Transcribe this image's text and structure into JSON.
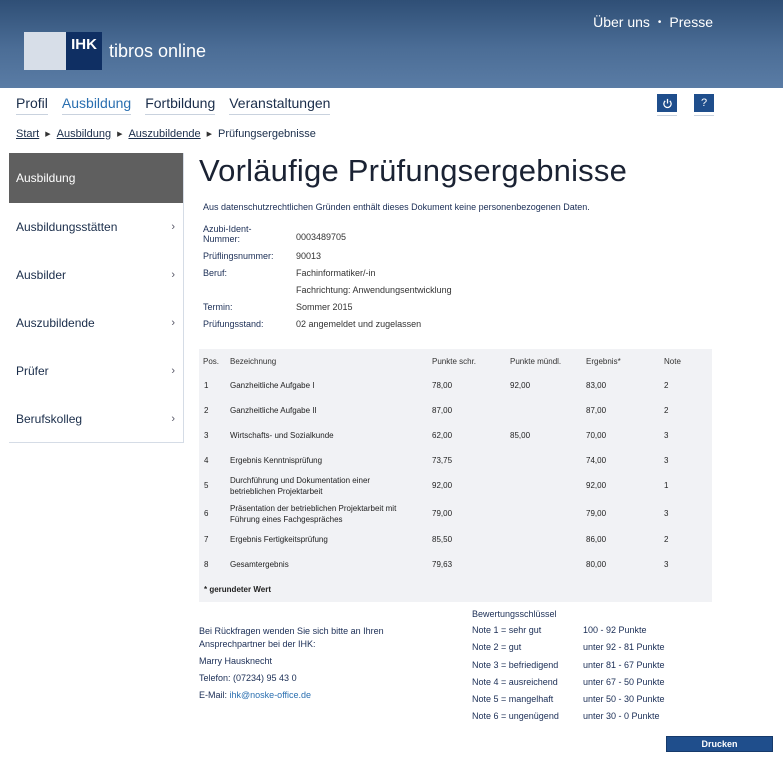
{
  "header": {
    "logo_mark": "IHK",
    "app_name": "tibros online",
    "links": [
      "Über uns",
      "Presse"
    ]
  },
  "nav": {
    "items": [
      "Profil",
      "Ausbildung",
      "Fortbildung",
      "Veranstaltungen"
    ],
    "active": "Ausbildung",
    "power_icon": "power-icon",
    "help_label": "?"
  },
  "breadcrumb": [
    "Start",
    "Ausbildung",
    "Auszubildende",
    "Prüfungsergebnisse"
  ],
  "sidebar": {
    "items": [
      {
        "label": "Ausbildung",
        "active": true
      },
      {
        "label": "Ausbildungsstätten"
      },
      {
        "label": "Ausbilder"
      },
      {
        "label": "Auszubildende"
      },
      {
        "label": "Prüfer"
      },
      {
        "label": "Berufskolleg"
      }
    ]
  },
  "main": {
    "title": "Vorläufige Prüfungsergebnisse",
    "note": "Aus datenschutzrechtlichen Gründen enthält dieses Dokument keine personenbezogenen Daten.",
    "meta": {
      "azubi_label": "Azubi-Ident-Nummer:",
      "azubi_label_line1": "Azubi-Ident-",
      "azubi_label_line2": "Nummer:",
      "azubi_value": "0003489705",
      "pruefling_label": "Prüflingsnummer:",
      "pruefling_value": "90013",
      "beruf_label": "Beruf:",
      "beruf_value": "Fachinformatiker/-in",
      "fachrichtung_value": "Fachrichtung: Anwendungsentwicklung",
      "termin_label": "Termin:",
      "termin_value": "Sommer 2015",
      "stand_label": "Prüfungsstand:",
      "stand_value": "02 angemeldet und zugelassen"
    }
  },
  "results": {
    "headers": [
      "Pos.",
      "Bezeichnung",
      "Punkte schr.",
      "Punkte mündl.",
      "Ergebnis*",
      "Note"
    ],
    "rows": [
      {
        "pos": "1",
        "bez1": "Ganzheitliche Aufgabe I",
        "bez2": "",
        "schr": "78,00",
        "muendl": "92,00",
        "erg": "83,00",
        "note": "2"
      },
      {
        "pos": "2",
        "bez1": "Ganzheitliche Aufgabe II",
        "bez2": "",
        "schr": "87,00",
        "muendl": "",
        "erg": "87,00",
        "note": "2"
      },
      {
        "pos": "3",
        "bez1": "Wirtschafts- und Sozialkunde",
        "bez2": "",
        "schr": "62,00",
        "muendl": "85,00",
        "erg": "70,00",
        "note": "3"
      },
      {
        "pos": "4",
        "bez1": "Ergebnis Kenntnisprüfung",
        "bez2": "",
        "schr": "73,75",
        "muendl": "",
        "erg": "74,00",
        "note": "3"
      },
      {
        "pos": "5",
        "bez1": "Durchführung und Dokumentation einer",
        "bez2": "betrieblichen Projektarbeit",
        "schr": "92,00",
        "muendl": "",
        "erg": "92,00",
        "note": "1"
      },
      {
        "pos": "6",
        "bez1": "Präsentation der betrieblichen Projektarbeit mit",
        "bez2": "Führung eines Fachgespräches",
        "schr": "79,00",
        "muendl": "",
        "erg": "79,00",
        "note": "3"
      },
      {
        "pos": "7",
        "bez1": "Ergebnis Fertigkeitsprüfung",
        "bez2": "",
        "schr": "85,50",
        "muendl": "",
        "erg": "86,00",
        "note": "2"
      },
      {
        "pos": "8",
        "bez1": "Gesamtergebnis",
        "bez2": "",
        "schr": "79,63",
        "muendl": "",
        "erg": "80,00",
        "note": "3"
      }
    ],
    "footnote": "* gerundeter Wert"
  },
  "contact": {
    "line1": "Bei Rückfragen wenden Sie sich bitte an Ihren",
    "line2": "Ansprechpartner bei der IHK:",
    "name": "Marry Hausknecht",
    "phone": "Telefon: (07234) 95 43 0",
    "email_label": "E-Mail:",
    "email": "ihk@noske-office.de"
  },
  "key": {
    "title": "Bewertungsschlüssel",
    "rows": [
      {
        "note": "Note 1 = sehr gut",
        "range": "100 - 92 Punkte"
      },
      {
        "note": "Note 2 = gut",
        "range": "unter 92 - 81 Punkte"
      },
      {
        "note": "Note 3 = befriedigend",
        "range": "unter 81 - 67 Punkte"
      },
      {
        "note": "Note 4 = ausreichend",
        "range": "unter 67 - 50 Punkte"
      },
      {
        "note": "Note 5 = mangelhaft",
        "range": "unter 50 - 30 Punkte"
      },
      {
        "note": "Note 6 = ungenügend",
        "range": "unter 30 - 0 Punkte"
      }
    ]
  },
  "actions": {
    "print_label": "Drucken"
  },
  "colors": {
    "header_dark": "#2f4f76",
    "accent": "#1f4e8c",
    "link": "#2a6fb0",
    "sidebar_active": "#5f5f5f"
  }
}
